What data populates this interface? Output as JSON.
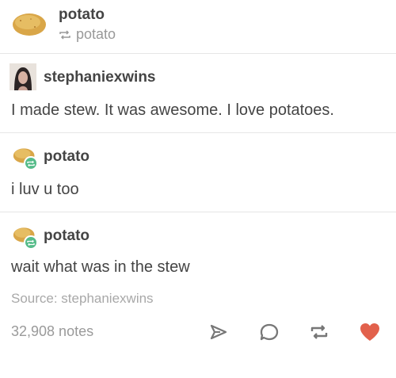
{
  "header": {
    "blog_name": "potato",
    "reblog_label": "potato"
  },
  "posts": [
    {
      "username": "stephaniexwins",
      "text": "I made stew. It was awesome. I love potatoes."
    },
    {
      "username": "potato",
      "text": "i luv u too"
    },
    {
      "username": "potato",
      "text": "wait what was in the stew"
    }
  ],
  "source": "Source: stephaniexwins",
  "notes": "32,908 notes",
  "icons": {
    "reblog": "reblog-icon",
    "share": "share-icon",
    "reply": "reply-icon",
    "like": "heart-icon"
  },
  "colors": {
    "text": "#444444",
    "muted": "#999999",
    "reblog_green": "#56bc8a",
    "heart": "#e2614c"
  }
}
